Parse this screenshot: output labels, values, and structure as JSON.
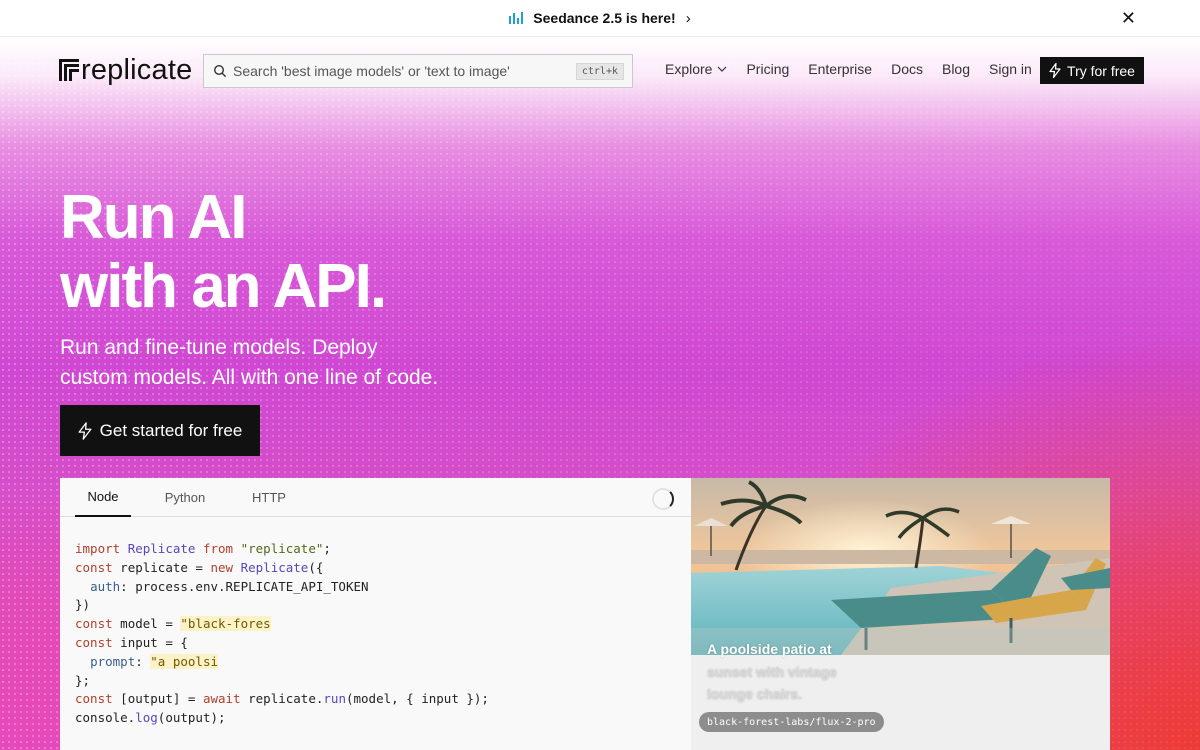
{
  "announcement": {
    "text": "Seedance 2.5 is here!",
    "bars_color": "#1fa0d8",
    "chevron_icon": "chevron-right-icon",
    "close_icon": "close-icon"
  },
  "header": {
    "logo_text": "replicate",
    "search_placeholder": "Search 'best image models' or 'text to image'",
    "search_shortcut": "ctrl+k",
    "nav": {
      "explore": "Explore",
      "pricing": "Pricing",
      "enterprise": "Enterprise",
      "docs": "Docs",
      "blog": "Blog",
      "signin": "Sign in"
    },
    "try_label": "Try for free"
  },
  "hero": {
    "title_line1": "Run AI",
    "title_line2": "with an API.",
    "subtitle_line1": "Run and fine-tune models. Deploy",
    "subtitle_line2": "custom models. All with one line of code.",
    "cta_label": "Get started for free",
    "colors": {
      "accent_magenta": "#d85ad8",
      "accent_red": "#ee3a30"
    }
  },
  "code_panel": {
    "tabs": [
      "Node",
      "Python",
      "HTTP"
    ],
    "active_tab": "Node",
    "lines": [
      "import Replicate from \"replicate\";",
      "const replicate = new Replicate({",
      "  auth: process.env.REPLICATE_API_TOKEN",
      "})",
      "const model = \"black-fores",
      "const input = {",
      "  prompt: \"a poolsi",
      "};",
      "const [output] = await replicate.run(model, { input });",
      "console.log(output);"
    ],
    "tokens": {
      "import": "import",
      "Replicate": "Replicate",
      "from": "from",
      "pkg": "\"replicate\"",
      "semicolon": ";",
      "const": "const",
      "replicate_var": " replicate = ",
      "new": "new",
      "open_obj": "({",
      "auth": "auth",
      "auth_rest": ": process.env.REPLICATE_API_TOKEN",
      "close_paren": "})",
      "model_var": " model = ",
      "model_val": "\"black-fores",
      "input_var": " input = {",
      "prompt": "prompt",
      "colon": ": ",
      "prompt_val": "\"a poolsi",
      "close_brace": "};",
      "output_var": " [output] = ",
      "await": "await",
      "run_pre": " replicate.",
      "run": "run",
      "run_args": "(model, { input });",
      "console": "console.",
      "log": "log",
      "log_args": "(output);"
    }
  },
  "image_card": {
    "caption_line1": "A poolside patio at",
    "caption_line2": "sunset with vintage",
    "caption_line3": "lounge chairs.",
    "model_tag": "black-forest-labs/flux-2-pro"
  }
}
